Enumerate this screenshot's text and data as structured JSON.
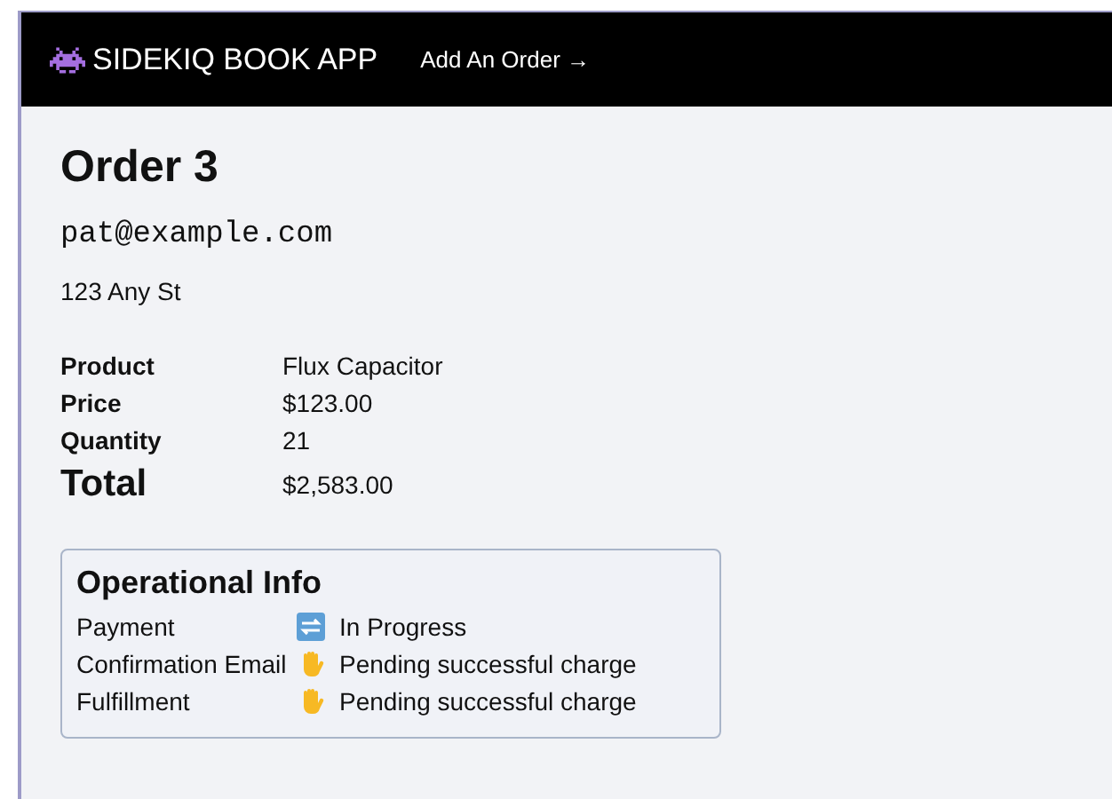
{
  "navbar": {
    "brand": "SIDEKIQ BOOK APP",
    "link": "Add An Order →"
  },
  "order": {
    "title": "Order 3",
    "email": "pat@example.com",
    "address": "123 Any St",
    "details": [
      {
        "label": "Product",
        "value": "Flux Capacitor",
        "kind": "normal"
      },
      {
        "label": "Price",
        "value": "$123.00",
        "kind": "normal"
      },
      {
        "label": "Quantity",
        "value": "21",
        "kind": "normal"
      },
      {
        "label": "Total",
        "value": "$2,583.00",
        "kind": "total"
      }
    ]
  },
  "operational_info": {
    "title": "Operational Info",
    "rows": [
      {
        "label": "Payment",
        "kind": "in_progress",
        "status": "In Progress"
      },
      {
        "label": "Confirmation Email",
        "kind": "pending",
        "status": "Pending successful charge"
      },
      {
        "label": "Fulfillment",
        "kind": "pending",
        "status": "Pending successful charge"
      }
    ]
  }
}
